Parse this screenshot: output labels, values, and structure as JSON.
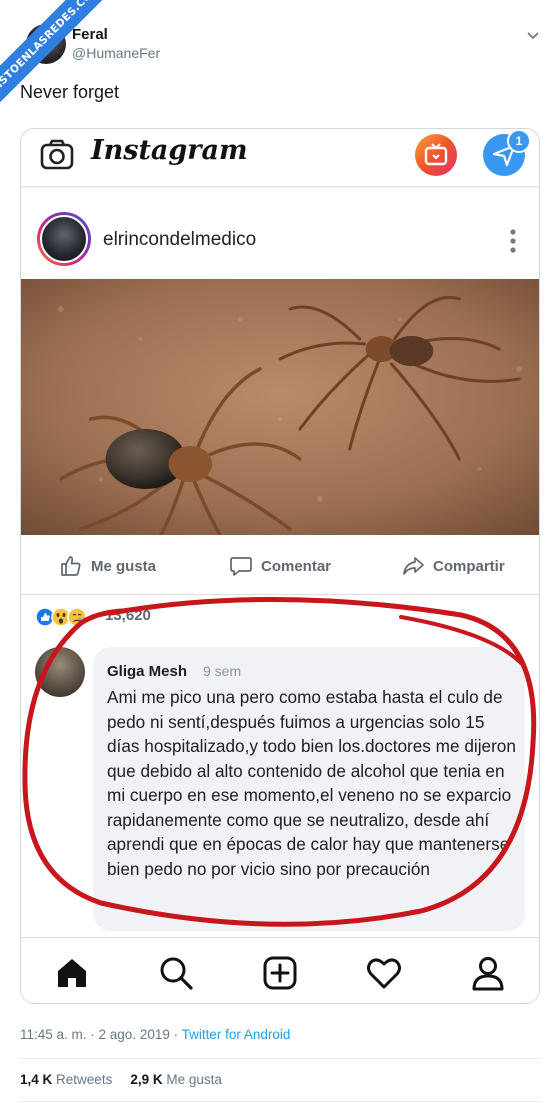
{
  "watermark": "VISTOENLASREDES.COM",
  "tweet": {
    "author_name": "Feral",
    "author_handle": "@HumaneFer",
    "text": "Never forget",
    "timestamp": "11:45 a. m. · 2 ago. 2019 · ",
    "source": "Twitter for Android",
    "retweets_count": "1,4 K",
    "retweets_label": "Retweets",
    "likes_count": "2,9 K",
    "likes_label": "Me gusta"
  },
  "instagram": {
    "logo": "Instagram",
    "dm_badge": "1",
    "post_username": "elrincondelmedico",
    "icons": [
      "camera-icon",
      "igtv-icon",
      "direct-message-icon",
      "more-options-icon",
      "home-icon",
      "search-icon",
      "add-post-icon",
      "heart-icon",
      "profile-icon"
    ]
  },
  "facebook": {
    "like_label": "Me gusta",
    "comment_label": "Comentar",
    "share_label": "Compartir",
    "reaction_count": "13,620",
    "comment": {
      "author": "Gliga Mesh",
      "time": "9 sem",
      "text": "Ami me pico una pero como estaba hasta el culo de pedo ni sentí,después fuimos a urgencias solo 15 días hospitalizado,y todo bien los.doctores me dijeron que debido al alto contenido de alcohol que tenia en mi cuerpo en ese momento,el veneno no se exparcio rapidanemente como que se neutralizo, desde ahí aprendi que en épocas de calor hay que mantenerse bien pedo no por vicio sino por precaución"
    }
  },
  "colors": {
    "twitter_blue": "#1da1f2",
    "ribbon_blue": "#2f7fe0",
    "annotation_red": "#c8161d",
    "ig_dm_blue": "#3897f0"
  }
}
